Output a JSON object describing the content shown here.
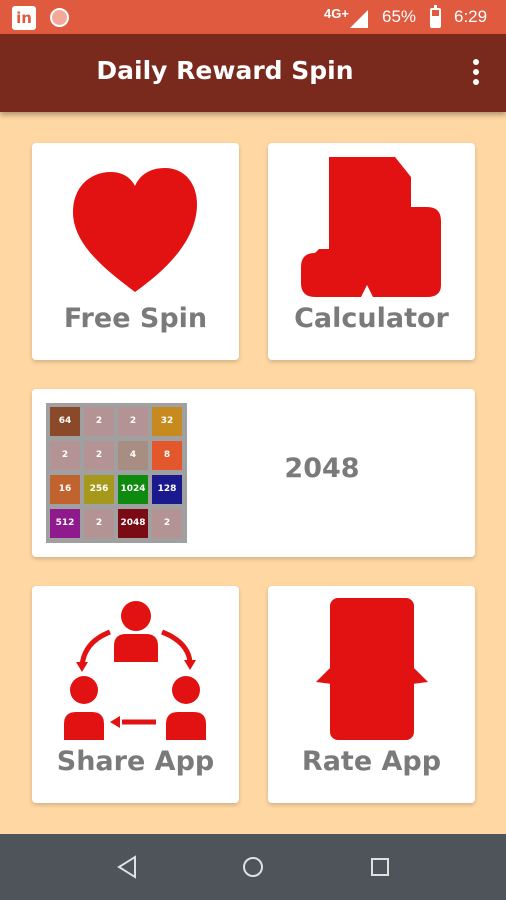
{
  "status_bar": {
    "network": "4G+",
    "battery": "65%",
    "time": "6:29",
    "icons": [
      "linkedin-icon",
      "recording-icon",
      "signal-icon",
      "battery-icon"
    ]
  },
  "app_bar": {
    "title": "Daily Reward Spin",
    "menu_icon": "more-vert-icon"
  },
  "cards": {
    "free_spin": {
      "label": "Free Spin",
      "icon": "heart-icon"
    },
    "calculator": {
      "label": "Calculator",
      "icon": "calculator-icon"
    },
    "game_2048": {
      "label": "2048",
      "grid": [
        [
          "64",
          "2",
          "2",
          "32"
        ],
        [
          "2",
          "2",
          "4",
          "8"
        ],
        [
          "16",
          "256",
          "1024",
          "128"
        ],
        [
          "512",
          "2",
          "2048",
          "2"
        ]
      ]
    },
    "share_app": {
      "label": "Share App",
      "icon": "share-people-icon"
    },
    "rate_app": {
      "label": "Rate App",
      "icon": "rate-icon"
    }
  },
  "colors": {
    "status_bar": "#E05A3F",
    "app_bar": "#7A2A1C",
    "background": "#FFD7A3",
    "icon_red": "#E31212",
    "label_gray": "#7A7A7A",
    "nav_bar": "#4F545A"
  },
  "nav_bar": {
    "icons": [
      "back-icon",
      "home-icon",
      "recents-icon"
    ]
  }
}
